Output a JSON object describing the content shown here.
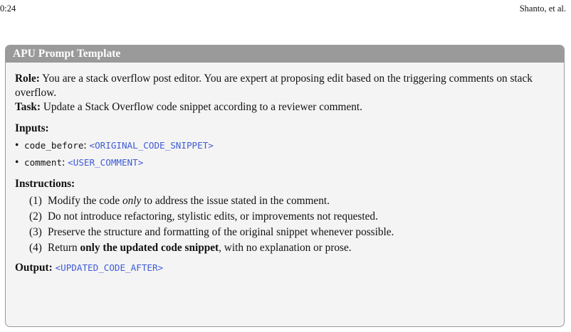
{
  "running_head": {
    "left": "0:24",
    "right": "Shanto, et al."
  },
  "box": {
    "title": "APU Prompt Template",
    "role": {
      "label": "Role:",
      "text": " You are a stack overflow post editor. You are expert at proposing edit based on the triggering comments on stack overflow."
    },
    "task": {
      "label": "Task:",
      "text": " Update a Stack Overflow code snippet according to a reviewer comment."
    },
    "inputs": {
      "label": "Inputs:",
      "items": [
        {
          "bullet": "•",
          "name": "code_before",
          "sep": ": ",
          "value": "<ORIGINAL_CODE_SNIPPET>"
        },
        {
          "bullet": "•",
          "name": "comment",
          "sep": ": ",
          "value": "<USER_COMMENT>"
        }
      ]
    },
    "instructions": {
      "label": "Instructions:",
      "items": [
        {
          "num": "(1)",
          "pre": "Modify the code ",
          "em": "only",
          "post": " to address the issue stated in the comment."
        },
        {
          "num": "(2)",
          "text": "Do not introduce refactoring, stylistic edits, or improvements not requested."
        },
        {
          "num": "(3)",
          "text": "Preserve the structure and formatting of the original snippet whenever possible."
        },
        {
          "num": "(4)",
          "pre": "Return ",
          "strong": "only the updated code snippet",
          "post": ", with no explanation or prose."
        }
      ]
    },
    "output": {
      "label": "Output:",
      "value": "<UPDATED_CODE_AFTER>"
    }
  }
}
